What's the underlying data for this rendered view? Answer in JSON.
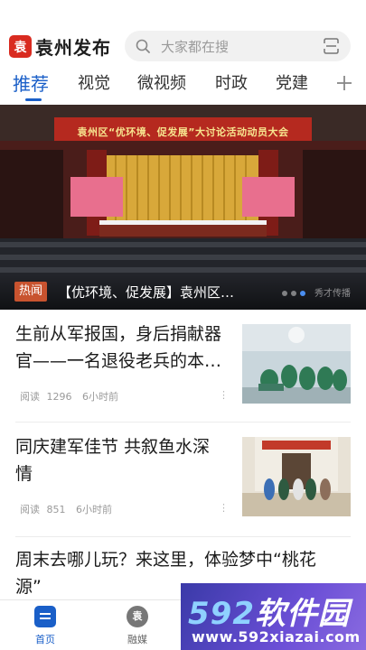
{
  "header": {
    "logo_mark": "袁",
    "app_title": "袁州发布",
    "search_placeholder": "大家都在搜"
  },
  "tabs": [
    {
      "label": "推荐",
      "active": true
    },
    {
      "label": "视觉",
      "active": false
    },
    {
      "label": "微视频",
      "active": false
    },
    {
      "label": "时政",
      "active": false
    },
    {
      "label": "党建",
      "active": false
    }
  ],
  "banner": {
    "stage_banner_text": "袁州区“优环境、促发展”大讨论活动动员大会",
    "badge": "热闻",
    "caption": "【优环境、促发展】袁州区…",
    "watermark": "秀才传播",
    "active_slide_index": 2,
    "slide_count": 3
  },
  "news": [
    {
      "title_line1": "生前从军报国，身后捐献器",
      "title_line2": "官——一名退役老兵的本…",
      "read_label": "阅读",
      "reads": "1296",
      "time": "6小时前",
      "more": "⋮"
    },
    {
      "title_line1": "同庆建军佳节 共叙鱼水深",
      "title_line2": "情",
      "read_label": "阅读",
      "reads": "851",
      "time": "6小时前",
      "more": "⋮"
    },
    {
      "title_line1": "周末去哪儿玩？来这里，体验梦中“桃花",
      "title_line2": "源”"
    }
  ],
  "bottom_nav": [
    {
      "label": "首页",
      "active": true
    },
    {
      "label": "融媒",
      "active": false
    }
  ],
  "site_watermark": {
    "main_prefix": "592",
    "main_suffix": "软件园",
    "url": "www.592xiazai.com"
  },
  "colors": {
    "accent": "#1a5fc8",
    "brand_red": "#d92b20",
    "hot_badge": "#c8532f"
  }
}
